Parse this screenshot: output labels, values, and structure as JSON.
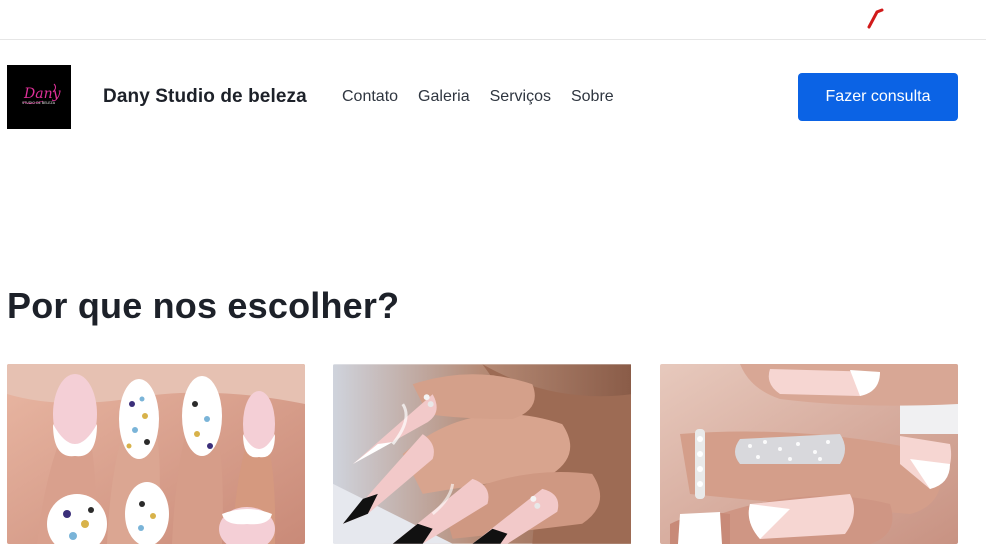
{
  "header": {
    "brand_name": "Dany Studio de beleza",
    "logo_text": "Dany",
    "logo_subtext": "STUDIO DE BELEZA",
    "nav": [
      {
        "label": "Contato"
      },
      {
        "label": "Galeria"
      },
      {
        "label": "Serviços"
      },
      {
        "label": "Sobre"
      }
    ],
    "cta_label": "Fazer consulta"
  },
  "section": {
    "title": "Por que nos escolher?"
  },
  "gallery": {
    "items": [
      {
        "icon": "nail-photo-leopard-french"
      },
      {
        "icon": "nail-photo-stiletto-black-tips"
      },
      {
        "icon": "nail-photo-white-french-glitter"
      }
    ]
  },
  "colors": {
    "cta_background": "#0b63e5",
    "logo_background": "#000000",
    "logo_accent": "#e0309a",
    "cursor_mark": "#d11a1a"
  }
}
